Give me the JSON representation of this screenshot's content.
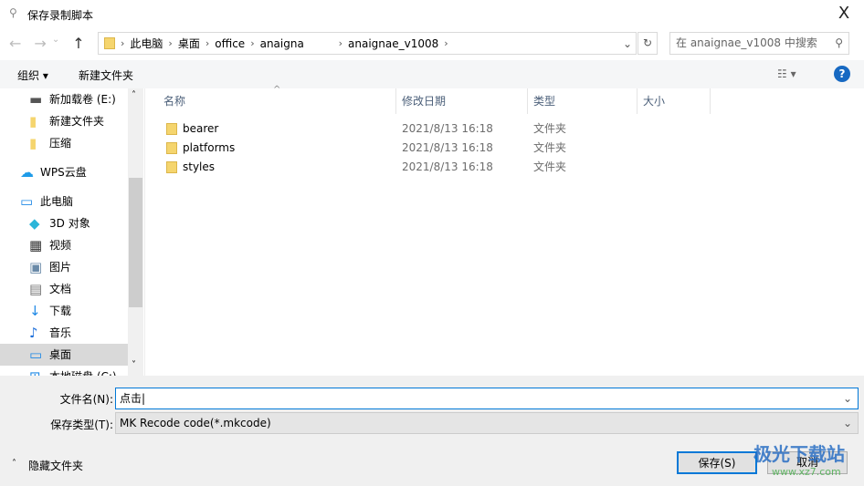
{
  "window": {
    "title": "保存录制脚本",
    "close": "X"
  },
  "address": {
    "crumbs": [
      "此电脑",
      "桌面",
      "office",
      "anaigna",
      "anaignae_v1008"
    ],
    "search_placeholder": "在 anaignae_v1008 中搜索"
  },
  "toolbar": {
    "organize": "组织 ▾",
    "new_folder": "新建文件夹",
    "help": "?"
  },
  "nav": {
    "items": [
      {
        "label": "新加载卷 (E:)",
        "icon": "drive-icon"
      },
      {
        "label": "新建文件夹",
        "icon": "folder-icon"
      },
      {
        "label": "压缩",
        "icon": "folder-icon"
      },
      {
        "label": "WPS云盘",
        "icon": "cloud-icon"
      },
      {
        "label": "此电脑",
        "icon": "computer-icon"
      },
      {
        "label": "3D 对象",
        "icon": "cube-icon"
      },
      {
        "label": "视频",
        "icon": "video-icon"
      },
      {
        "label": "图片",
        "icon": "picture-icon"
      },
      {
        "label": "文档",
        "icon": "document-icon"
      },
      {
        "label": "下载",
        "icon": "download-icon"
      },
      {
        "label": "音乐",
        "icon": "music-icon"
      },
      {
        "label": "桌面",
        "icon": "desktop-icon",
        "selected": true
      },
      {
        "label": "本地磁盘 (C:)",
        "icon": "windows-drive-icon"
      }
    ]
  },
  "files": {
    "columns": [
      "名称",
      "修改日期",
      "类型",
      "大小"
    ],
    "rows": [
      {
        "name": "bearer",
        "date": "2021/8/13 16:18",
        "type": "文件夹"
      },
      {
        "name": "platforms",
        "date": "2021/8/13 16:18",
        "type": "文件夹"
      },
      {
        "name": "styles",
        "date": "2021/8/13 16:18",
        "type": "文件夹"
      }
    ]
  },
  "form": {
    "filename_label": "文件名(N):",
    "filename_value": "点击",
    "filetype_label": "保存类型(T):",
    "filetype_value": "MK Recode code(*.mkcode)",
    "hide_folders": "隐藏文件夹",
    "save": "保存(S)",
    "cancel": "取消"
  },
  "watermark": {
    "text": "极光下载站",
    "url": "www.xz7.com"
  }
}
